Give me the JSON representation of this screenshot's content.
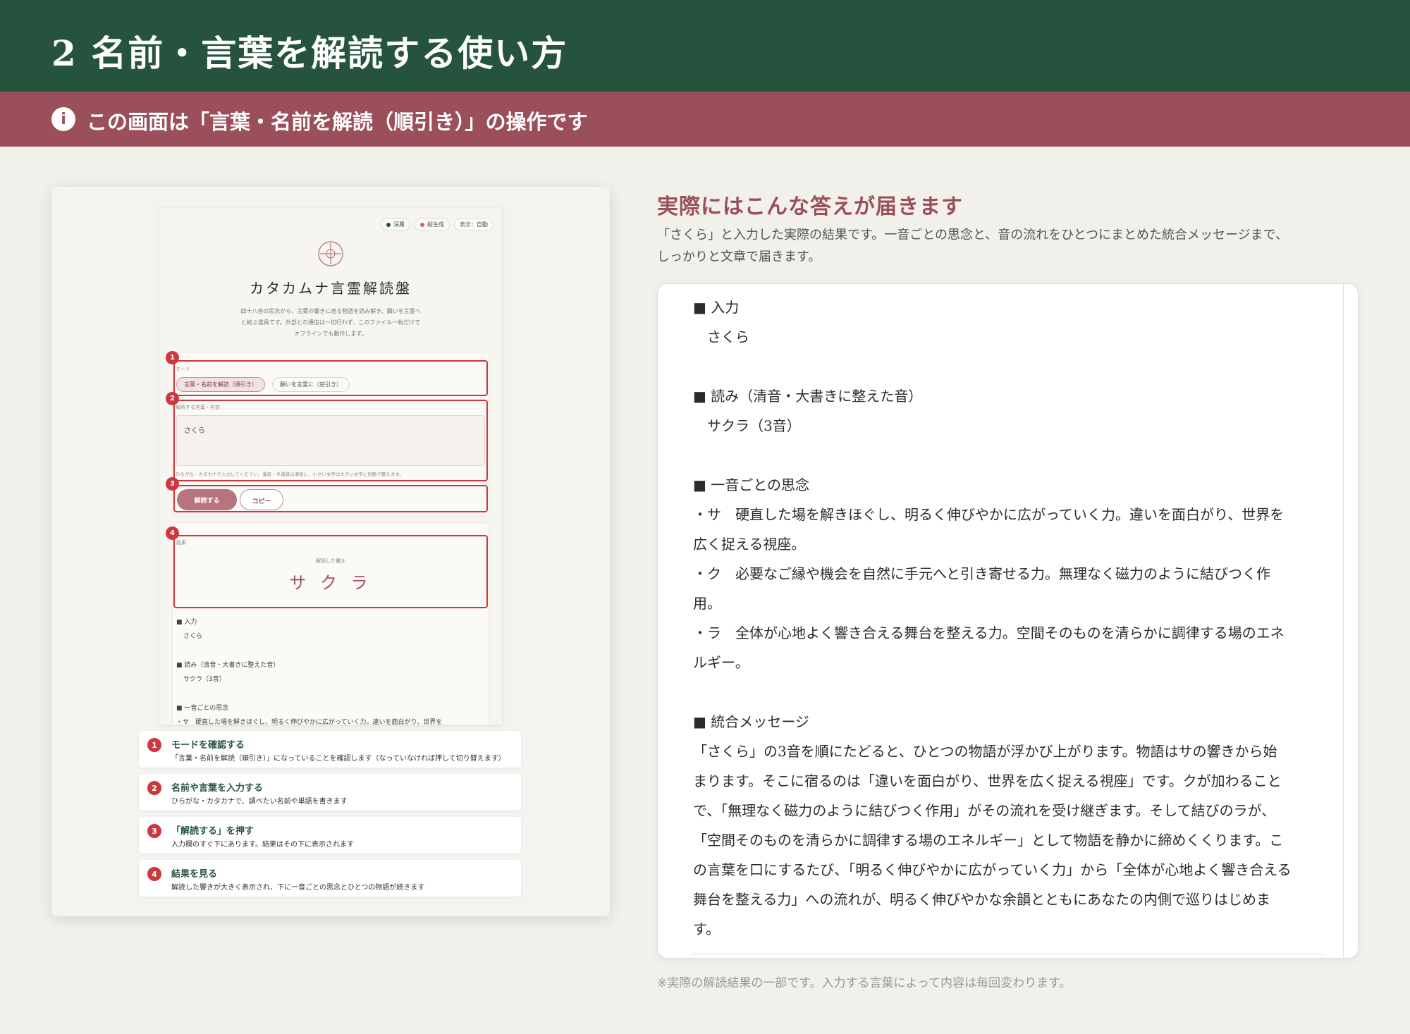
{
  "header": {
    "title": "2 名前・言葉を解読する使い方"
  },
  "banner": {
    "icon": "i",
    "text": "この画面は「言葉・名前を解読（順引き）」の操作です"
  },
  "screenshot": {
    "chips": [
      {
        "label": "深層",
        "color": "#26533e"
      },
      {
        "label": "縦生成",
        "color": "#c26b74"
      },
      {
        "label": "表示：自動"
      }
    ],
    "title": "カタカムナ言霊解読盤",
    "description": [
      "四十八音の思念から、言葉の響きに宿る物語を読み解き、願いを言霊へ",
      "と結ぶ道具です。外部との通信は一切行わず、このファイル一枚だけで",
      "オフラインでも動作します。"
    ],
    "mode_label": "モード",
    "mode_forward": "言葉・名前を解読（順引き）",
    "mode_reverse": "願いを言霊に（逆引き）",
    "input_label": "解読する言葉・名前",
    "input_value": "さくら",
    "input_hint": "ひらがな・カタカナで入力してください。濁音・半濁音は清音に、小さい文字は大きい文字に自動で整えます。",
    "decode_button": "解読する",
    "copy_button": "コピー",
    "result_label": "結果",
    "result_caption": "解読した響き",
    "result_value": "サ ク ラ",
    "lines": [
      "■ 入力",
      "さくら",
      "■ 読み（清音・大書きに整えた音）",
      "サクラ（3音）",
      "■ 一音ごとの思念",
      "・サ　硬直した場を解きほぐし、明るく伸びやかに広がっていく力。違いを面白がり、世界を"
    ],
    "markers": [
      "1",
      "2",
      "3",
      "4"
    ]
  },
  "steps": [
    {
      "num": "1",
      "title": "モードを確認する",
      "desc": "「言葉・名前を解読（順引き）」になっていることを確認します（なっていなければ押して切り替えます）"
    },
    {
      "num": "2",
      "title": "名前や言葉を入力する",
      "desc": "ひらがな・カタカナで、調べたい名前や単語を書きます"
    },
    {
      "num": "3",
      "title": "「解読する」を押す",
      "desc": "入力欄のすぐ下にあります。結果はその下に表示されます"
    },
    {
      "num": "4",
      "title": "結果を見る",
      "desc": "解読した響きが大きく表示され、下に一音ごとの思念とひとつの物語が続きます"
    }
  ],
  "result_panel": {
    "title": "実際にはこんな答えが届きます",
    "desc": [
      "「さくら」と入力した実際の結果です。一音ごとの思念と、音の流れをひとつにまとめた統合メッセージまで、",
      "しっかりと文章で届きます。"
    ],
    "lines": [
      "■ 入力",
      "　さくら",
      "",
      "■ 読み（清音・大書きに整えた音）",
      "　サクラ（3音）",
      "",
      "■ 一音ごとの思念",
      "・サ　硬直した場を解きほぐし、明るく伸びやかに広がっていく力。違いを面白がり、世界を",
      "広く捉える視座。",
      "・ク　必要なご縁や機会を自然に手元へと引き寄せる力。無理なく磁力のように結びつく作",
      "用。",
      "・ラ　全体が心地よく響き合える舞台を整える力。空間そのものを清らかに調律する場のエネ",
      "ルギー。",
      "",
      "■ 統合メッセージ",
      "「さくら」の3音を順にたどると、ひとつの物語が浮かび上がります。物語はサの響きから始",
      "まります。そこに宿るのは「違いを面白がり、世界を広く捉える視座」です。クが加わること",
      "で、「無理なく磁力のように結びつく作用」がその流れを受け継ぎます。そして結びのラが、",
      "「空間そのものを清らかに調律する場のエネルギー」として物語を静かに締めくくります。こ",
      "の言葉を口にするたび、「明るく伸びやかに広がっていく力」から「全体が心地よく響き合える",
      "舞台を整える力」への流れが、明るく伸びやかな余韻とともにあなたの内側で巡りはじめま",
      "す。"
    ]
  },
  "footnote": "※実際の解読結果の一部です。入力する言葉によって内容は毎回変わります。"
}
